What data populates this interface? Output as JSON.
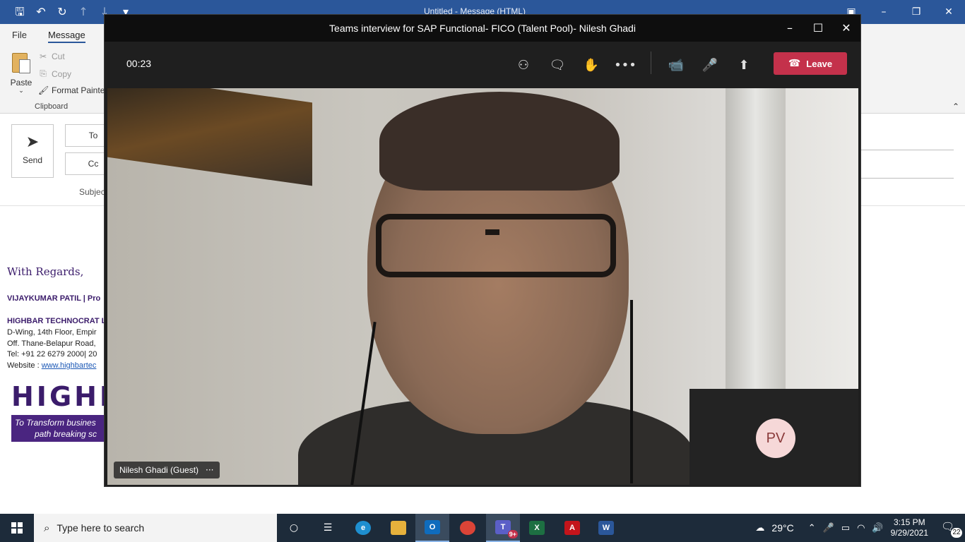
{
  "outlook": {
    "window_title": "Untitled  -  Message (HTML)",
    "tabs": [
      "File",
      "Message"
    ],
    "ribbon": {
      "paste": "Paste",
      "cut": "Cut",
      "copy": "Copy",
      "format_painter": "Format Painter",
      "group_label": "Clipboard"
    },
    "compose": {
      "send": "Send",
      "to": "To",
      "cc": "Cc",
      "subject": "Subject"
    },
    "signature": {
      "regards": "With Regards,",
      "name": "VIJAYKUMAR PATIL | Pro",
      "company": "HIGHBAR TECHNOCRAT L",
      "address1": "D-Wing, 14th Floor, Empir",
      "address2": "Off. Thane-Belapur Road,",
      "tel": "Tel: +91 22 6279 2000| 20",
      "website_label": "Website : ",
      "website_link": "www.highbartec",
      "logo_text": "HIGHB",
      "tagline1": "To Transform busines",
      "tagline2": "path breaking sc"
    }
  },
  "teams": {
    "title": "Teams interview for SAP Functional- FICO (Talent Pool)- Nilesh Ghadi",
    "timer": "00:23",
    "leave": "Leave",
    "participant_name": "Nilesh Ghadi (Guest)",
    "more_glyph": "···",
    "self_initials": "PV"
  },
  "taskbar": {
    "search_placeholder": "Type here to search",
    "weather": "29°C",
    "time": "3:15 PM",
    "date": "9/29/2021",
    "notification_count": "22",
    "teams_badge": "9+"
  },
  "colors": {
    "outlook_blue": "#2b579a",
    "leave_red": "#c4314b",
    "signature_purple": "#3b1c6b"
  }
}
